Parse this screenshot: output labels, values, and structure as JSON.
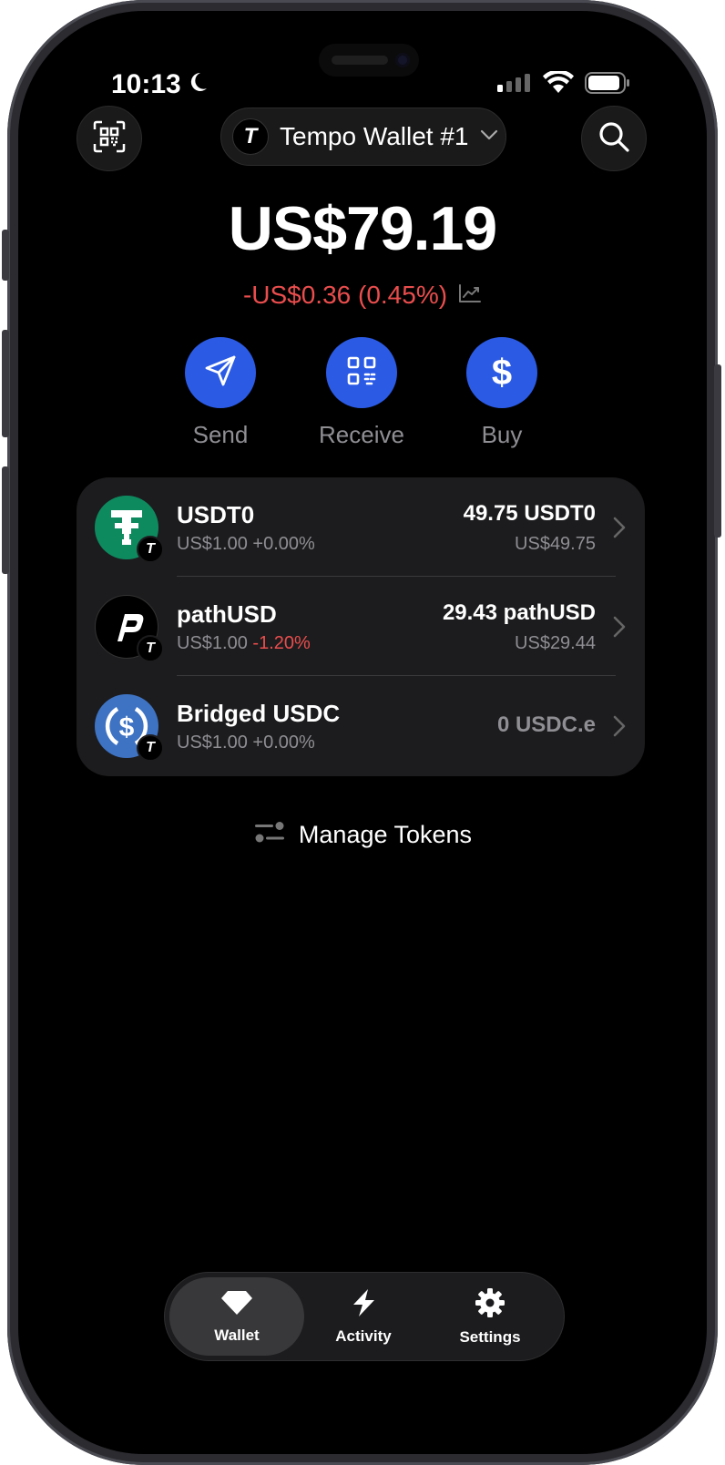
{
  "status_bar": {
    "time": "10:13"
  },
  "header": {
    "wallet_logo_letter": "T",
    "wallet_name": "Tempo Wallet #1"
  },
  "balance": {
    "total": "US$79.19",
    "change": "-US$0.36 (0.45%)"
  },
  "actions": [
    {
      "label": "Send",
      "icon": "send-icon"
    },
    {
      "label": "Receive",
      "icon": "qr-code-icon"
    },
    {
      "label": "Buy",
      "icon": "dollar-icon"
    }
  ],
  "tokens": [
    {
      "name": "USDT0",
      "price": "US$1.00",
      "change": "+0.00%",
      "amount": "49.75 USDT0",
      "value": "US$49.75",
      "icon_color": "#0e8a5f",
      "change_negative": false
    },
    {
      "name": "pathUSD",
      "price": "US$1.00",
      "change": "-1.20%",
      "amount": "29.43 pathUSD",
      "value": "US$29.44",
      "icon_color": "#000000",
      "change_negative": true
    },
    {
      "name": "Bridged USDC",
      "price": "US$1.00",
      "change": "+0.00%",
      "amount": "0 USDC.e",
      "value": "",
      "icon_color": "#3e73c4",
      "change_negative": false
    }
  ],
  "badge_letter": "T",
  "manage_tokens_label": "Manage Tokens",
  "tabs": [
    {
      "label": "Wallet",
      "icon": "diamond-icon",
      "active": true
    },
    {
      "label": "Activity",
      "icon": "lightning-icon",
      "active": false
    },
    {
      "label": "Settings",
      "icon": "gear-icon",
      "active": false
    }
  ],
  "colors": {
    "accent": "#2b5be5",
    "negative": "#ea4d4d",
    "card": "#1c1c1e",
    "muted": "#8e8e93"
  }
}
